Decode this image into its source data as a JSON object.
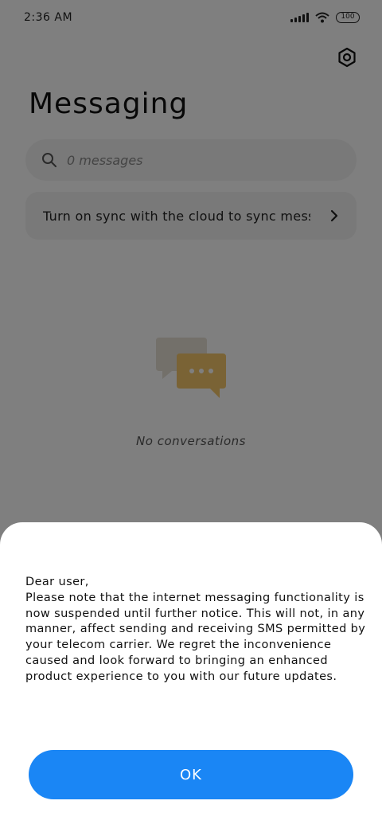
{
  "status_bar": {
    "time": "2:36 AM",
    "battery_level": "100"
  },
  "header": {
    "title": "Messaging",
    "settings_icon": "gear-icon"
  },
  "search": {
    "placeholder": "0 messages",
    "icon": "search-icon"
  },
  "sync_banner": {
    "text": "Turn on sync with the cloud to sync messages",
    "icon": "chevron-right-icon"
  },
  "empty_state": {
    "icon": "chat-bubbles-icon",
    "text": "No conversations"
  },
  "dialog": {
    "greeting": "Dear user,",
    "message": "Please note that the internet messaging functionality is now suspended until further notice. This will not, in any manner, affect sending and receiving SMS permitted by your telecom carrier. We regret the inconvenience caused and look forward to bringing an enhanced product experience to you with our future updates.",
    "ok_label": "OK"
  },
  "colors": {
    "accent": "#1a86f5",
    "scrim": "#000000",
    "empty_icon": "#f5c66a"
  }
}
